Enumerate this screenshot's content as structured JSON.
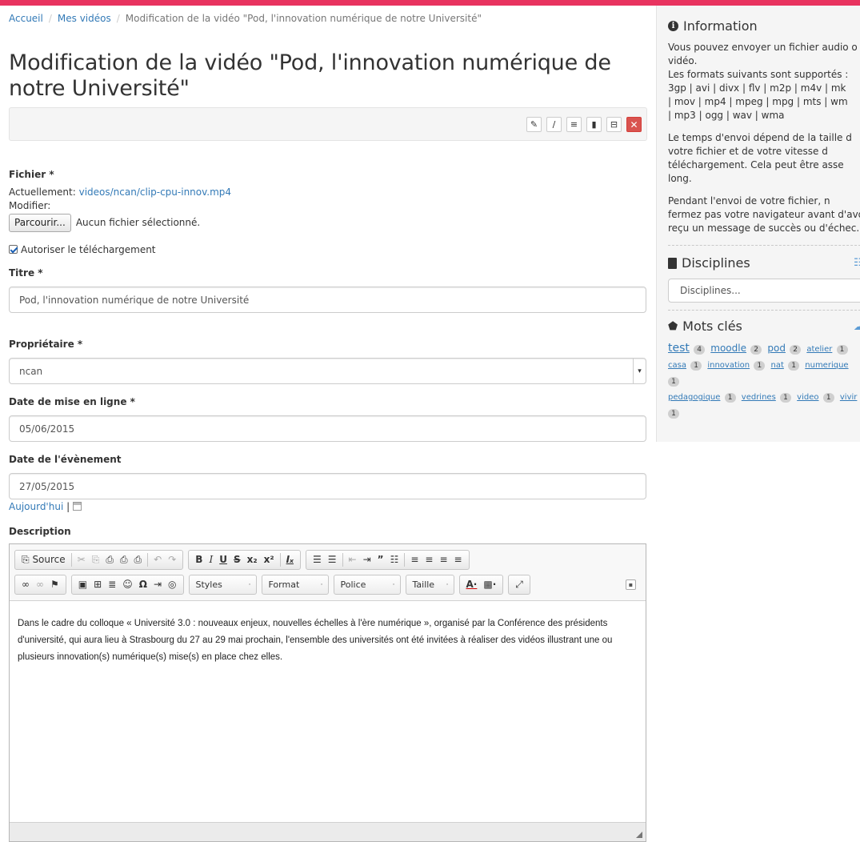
{
  "breadcrumb": {
    "home": "Accueil",
    "videos": "Mes vidéos",
    "current": "Modification de la vidéo \"Pod, l'innovation numérique de notre Université\""
  },
  "page_title": "Modification de la vidéo \"Pod, l'innovation numérique de notre Université\"",
  "toolbar_icons": [
    "pencil-icon",
    "paperclip-icon",
    "list-icon",
    "file-icon",
    "film-icon",
    "delete-icon"
  ],
  "form": {
    "file": {
      "label": "Fichier *",
      "current_label": "Actuellement:",
      "current_value": "videos/ncan/clip-cpu-innov.mp4",
      "modify_label": "Modifier:",
      "browse_button": "Parcourir...",
      "no_file": "Aucun fichier sélectionné."
    },
    "allow_download": {
      "label": "Autoriser le téléchargement",
      "checked": true
    },
    "title": {
      "label": "Titre *",
      "value": "Pod, l'innovation numérique de notre Université"
    },
    "owner": {
      "label": "Propriétaire *",
      "value": "ncan"
    },
    "publish_date": {
      "label": "Date de mise en ligne *",
      "value": "05/06/2015"
    },
    "event_date": {
      "label": "Date de l'évènement",
      "value": "27/05/2015",
      "today_link": "Aujourd'hui",
      "separator": "|"
    },
    "description": {
      "label": "Description",
      "source_label": "Source",
      "combos": {
        "styles": "Styles",
        "format": "Format",
        "font": "Police",
        "size": "Taille"
      },
      "content": "Dans le cadre du colloque « Université 3.0 : nouveaux enjeux, nouvelles échelles à l'ère numérique », organisé par la Conférence des présidents d'université, qui aura lieu à Strasbourg du 27 au 29 mai prochain, l'ensemble des universités ont été invitées à réaliser des vidéos illustrant une ou plusieurs innovation(s) numérique(s) mise(s) en place chez elles."
    }
  },
  "sidebar": {
    "info_title": "Information",
    "info_lines_1": [
      "Vous pouvez envoyer un fichier audio o",
      "vidéo.",
      "Les formats suivants sont supportés :",
      "3gp | avi | divx | flv | m2p | m4v | mk",
      "| mov | mp4 | mpeg | mpg | mts | wm",
      "| mp3 | ogg | wav | wma"
    ],
    "info_lines_2": [
      "Le temps d'envoi dépend de la taille d",
      "votre fichier et de votre vitesse d",
      "téléchargement. Cela peut être asse",
      "long."
    ],
    "info_lines_3": [
      "Pendant l'envoi de votre fichier, n",
      "fermez pas votre navigateur avant d'avo",
      "reçu un message de succès ou d'échec."
    ],
    "disciplines_title": "Disciplines",
    "disciplines_placeholder": "Disciplines...",
    "keywords_title": "Mots clés",
    "tags": [
      {
        "name": "test",
        "count": "4",
        "size": "big"
      },
      {
        "name": "moodle",
        "count": "2",
        "size": "mid"
      },
      {
        "name": "pod",
        "count": "2",
        "size": "mid"
      },
      {
        "name": "atelier",
        "count": "1",
        "size": "small"
      },
      {
        "name": "casa",
        "count": "1",
        "size": "small"
      },
      {
        "name": "innovation",
        "count": "1",
        "size": "small"
      },
      {
        "name": "nat",
        "count": "1",
        "size": "small"
      },
      {
        "name": "numerique",
        "count": "1",
        "size": "small"
      },
      {
        "name": "pedagogique",
        "count": "1",
        "size": "small"
      },
      {
        "name": "vedrines",
        "count": "1",
        "size": "small"
      },
      {
        "name": "video",
        "count": "1",
        "size": "small"
      },
      {
        "name": "vivir",
        "count": "1",
        "size": "small"
      }
    ],
    "trailing_badge": "1"
  },
  "colors": {
    "accent": "#e8335f",
    "link": "#337ab7",
    "danger": "#d9534f"
  }
}
